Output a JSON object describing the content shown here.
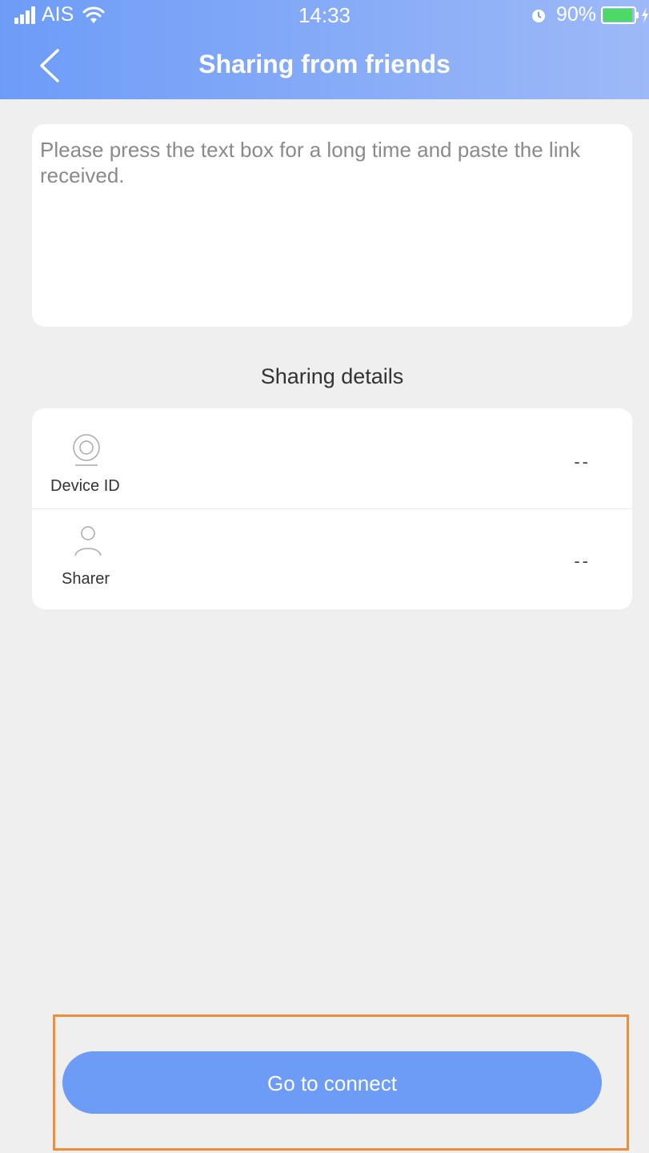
{
  "status_bar": {
    "carrier": "AIS",
    "time": "14:33",
    "battery_percent": "90%",
    "icons": [
      "signal-icon",
      "wifi-icon",
      "alarm-icon",
      "battery-icon",
      "charging-icon"
    ]
  },
  "header": {
    "title": "Sharing from friends",
    "back_icon": "back-chevron-icon"
  },
  "link_input": {
    "placeholder": "Please press the text box for a long time and paste the link received.",
    "value": ""
  },
  "details": {
    "title": "Sharing details",
    "rows": [
      {
        "label": "Device ID",
        "value": "--",
        "icon": "camera-icon"
      },
      {
        "label": "Sharer",
        "value": "--",
        "icon": "user-icon"
      }
    ]
  },
  "actions": {
    "connect_label": "Go to connect"
  },
  "colors": {
    "header_start": "#6d9cf7",
    "header_end": "#9db9f7",
    "accent": "#6d9cf7",
    "background": "#efefef",
    "highlight": "#f08c3a"
  }
}
